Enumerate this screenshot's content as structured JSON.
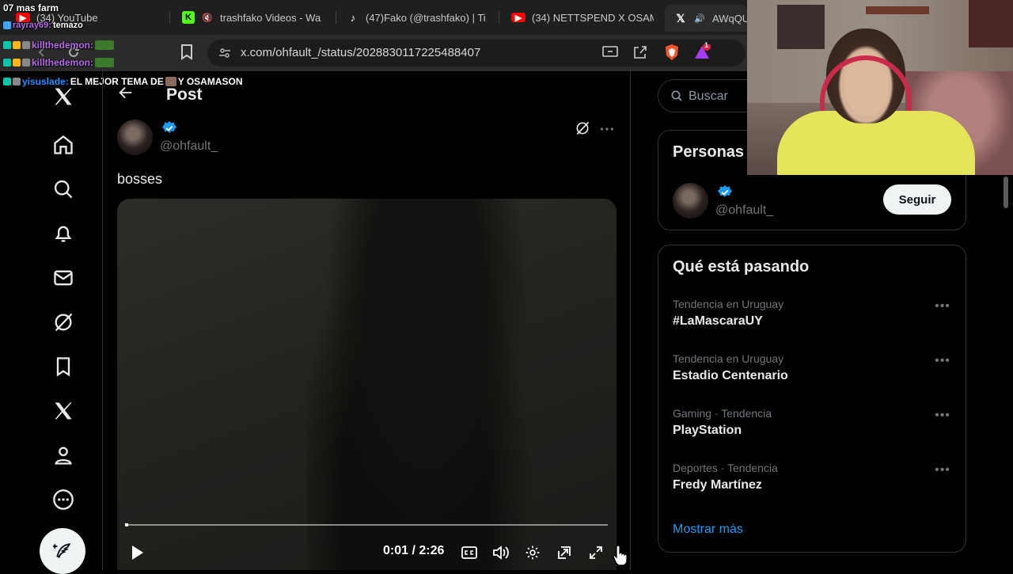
{
  "browser": {
    "tabs": [
      {
        "icon": "youtube-icon",
        "title": "(34) YouTube",
        "color": "#ff0000"
      },
      {
        "icon": "kick-icon",
        "title": "trashfako Videos - Wa",
        "color": "#53fc18"
      },
      {
        "icon": "tiktok-icon",
        "title": "(47)Fako (@trashfako) | Ti",
        "color": "#ffffff"
      },
      {
        "icon": "youtube-icon",
        "title": "(34) NETTSPEND X OSAM",
        "color": "#ff0000"
      },
      {
        "icon": "x-icon",
        "title": "AWqQU",
        "color": "#ffffff"
      }
    ],
    "url": "x.com/ohfault_/status/2028830117225488407",
    "notification_count": "1"
  },
  "chat_overlay": {
    "lines": [
      {
        "user": "",
        "text": "07 mas farm",
        "user_color": "#ffffff"
      },
      {
        "user": "rayray69:",
        "text": "temazo",
        "user_color": "#b66be6"
      },
      {
        "user": "killthedemon:",
        "text": "",
        "user_color": "#b66be6"
      },
      {
        "user": "killthedemon:",
        "text": "",
        "user_color": "#b66be6"
      },
      {
        "user": "yisuslade:",
        "text": "EL MEJOR TEMA DE",
        "text2": "Y OSAMASON",
        "user_color": "#1e90ff"
      }
    ]
  },
  "nav": {
    "items": [
      {
        "name": "x-logo-icon"
      },
      {
        "name": "home-icon"
      },
      {
        "name": "explore-icon"
      },
      {
        "name": "notifications-icon"
      },
      {
        "name": "messages-icon"
      },
      {
        "name": "grok-icon"
      },
      {
        "name": "bookmarks-icon"
      },
      {
        "name": "premium-icon"
      },
      {
        "name": "profile-icon"
      },
      {
        "name": "more-icon"
      }
    ]
  },
  "post": {
    "header_title": "Post",
    "author_handle": "@ohfault_",
    "text": "bosses",
    "video": {
      "current_time": "0:01",
      "separator": "/",
      "duration": "2:26",
      "progress": 0.007
    }
  },
  "sidebar": {
    "search_placeholder": "Buscar",
    "who_to_follow": {
      "title": "Personas",
      "user_handle": "@ohfault_",
      "follow_label": "Seguir"
    },
    "trends": {
      "title": "Qué está pasando",
      "items": [
        {
          "category": "Tendencia en Uruguay",
          "name": "#LaMascaraUY"
        },
        {
          "category": "Tendencia en Uruguay",
          "name": "Estadio Centenario"
        },
        {
          "category": "Gaming · Tendencia",
          "name": "PlayStation"
        },
        {
          "category": "Deportes · Tendencia",
          "name": "Fredy Martínez"
        }
      ],
      "show_more": "Mostrar más"
    }
  },
  "colors": {
    "accent": "#1d9bf0",
    "background": "#000000",
    "border": "#2f3336",
    "muted_text": "#71767b"
  }
}
